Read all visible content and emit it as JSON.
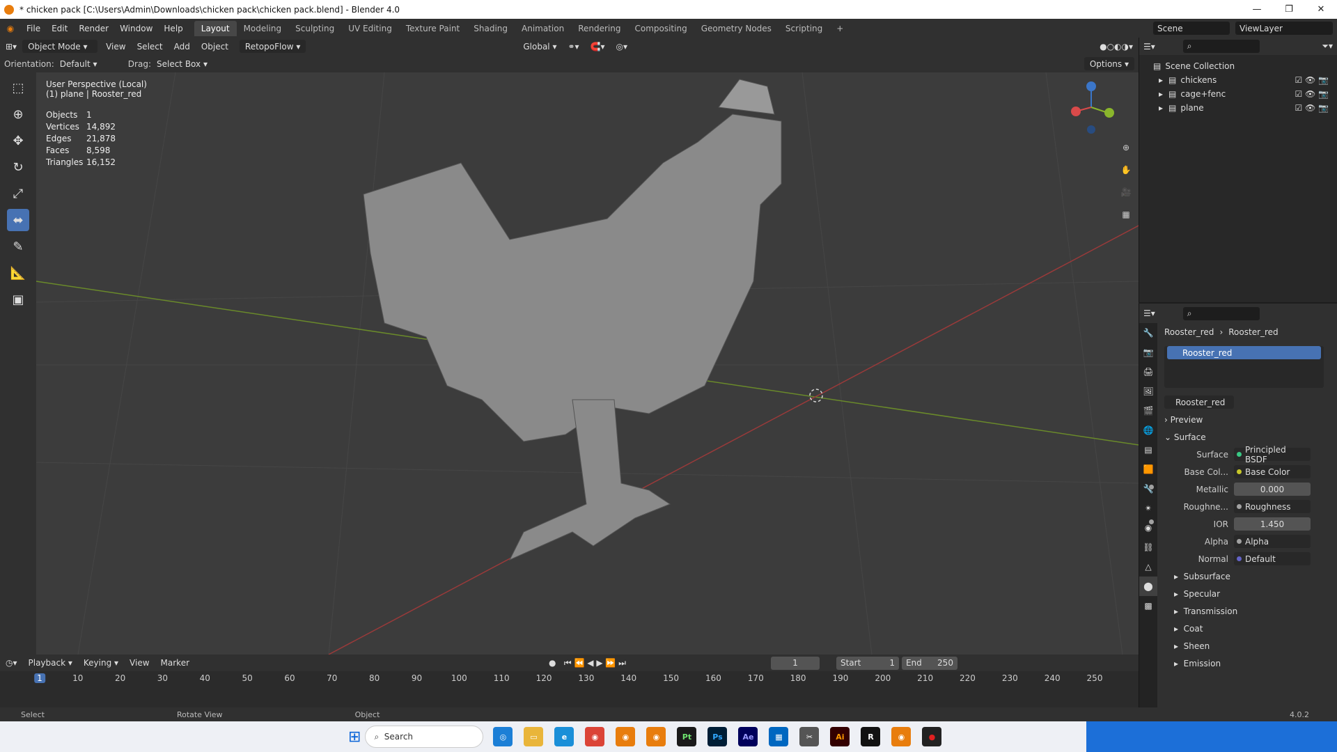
{
  "window": {
    "title": "* chicken pack [C:\\Users\\Admin\\Downloads\\chicken pack\\chicken pack.blend] - Blender 4.0"
  },
  "menu": [
    "File",
    "Edit",
    "Render",
    "Window",
    "Help"
  ],
  "workspaces": [
    "Layout",
    "Modeling",
    "Sculpting",
    "UV Editing",
    "Texture Paint",
    "Shading",
    "Animation",
    "Rendering",
    "Compositing",
    "Geometry Nodes",
    "Scripting"
  ],
  "active_workspace": "Layout",
  "scene": "Scene",
  "view_layer": "ViewLayer",
  "header": {
    "mode": "Object Mode",
    "view": "View",
    "select": "Select",
    "add": "Add",
    "object": "Object",
    "addon": "RetopoFlow",
    "transform": "Global",
    "options": "Options"
  },
  "header2": {
    "orientation_label": "Orientation:",
    "orientation": "Default",
    "drag_label": "Drag:",
    "drag": "Select Box"
  },
  "viewport": {
    "perspective": "User Perspective (Local)",
    "object": "(1) plane | Rooster_red",
    "stats": [
      [
        "Objects",
        "1"
      ],
      [
        "Vertices",
        "14,892"
      ],
      [
        "Edges",
        "21,878"
      ],
      [
        "Faces",
        "8,598"
      ],
      [
        "Triangles",
        "16,152"
      ]
    ]
  },
  "outliner": {
    "root": "Scene Collection",
    "items": [
      "chickens",
      "cage+fenc",
      "plane"
    ]
  },
  "properties": {
    "breadcrumb_obj": "Rooster_red",
    "breadcrumb_mat": "Rooster_red",
    "slot": "Rooster_red",
    "material": "Rooster_red",
    "preview": "Preview",
    "surface_panel": "Surface",
    "surface_label": "Surface",
    "surface_value": "Principled BSDF",
    "rows": [
      {
        "label": "Base Col...",
        "value": "Base Color",
        "type": "link",
        "color": "#c7c729"
      },
      {
        "label": "Metallic",
        "value": "0.000",
        "type": "num",
        "color": "#a1a1a1"
      },
      {
        "label": "Roughne...",
        "value": "Roughness",
        "type": "link",
        "color": "#a1a1a1"
      },
      {
        "label": "IOR",
        "value": "1.450",
        "type": "num",
        "color": "#a1a1a1"
      },
      {
        "label": "Alpha",
        "value": "Alpha",
        "type": "link",
        "color": "#a1a1a1"
      },
      {
        "label": "Normal",
        "value": "Default",
        "type": "link",
        "color": "#6363c7"
      }
    ],
    "subpanels": [
      "Subsurface",
      "Specular",
      "Transmission",
      "Coat",
      "Sheen",
      "Emission"
    ]
  },
  "timeline": {
    "playback": "Playback",
    "keying": "Keying",
    "view": "View",
    "marker": "Marker",
    "frame": "1",
    "start_label": "Start",
    "start": "1",
    "end_label": "End",
    "end": "250",
    "ticks": [
      "1",
      "10",
      "20",
      "30",
      "40",
      "50",
      "60",
      "70",
      "80",
      "90",
      "100",
      "110",
      "120",
      "130",
      "140",
      "150",
      "160",
      "170",
      "180",
      "190",
      "200",
      "210",
      "220",
      "230",
      "240",
      "250"
    ]
  },
  "status": {
    "select": "Select",
    "rotate": "Rotate View",
    "object": "Object",
    "version": "4.0.2"
  },
  "taskbar": {
    "search": "Search"
  }
}
